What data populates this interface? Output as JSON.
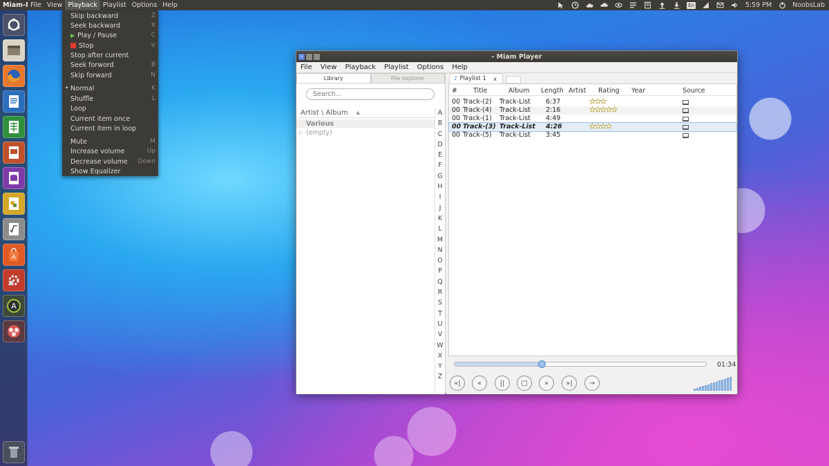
{
  "topbar": {
    "app_title": "Miam-Pl",
    "menus": [
      "File",
      "View",
      "Playback",
      "Playlist",
      "Options",
      "Help"
    ],
    "open_menu_index": 2,
    "time": "5:59 PM",
    "user": "NoobsLab",
    "keyboard_layout": "En",
    "indicator_icons": [
      "cursor-icon",
      "clock-icon",
      "weather-icon",
      "cloud-icon",
      "eye-icon",
      "list-icon",
      "bookmark-icon",
      "upload-icon",
      "download-icon",
      "keyboard-layout-icon",
      "network-icon",
      "mail-icon",
      "volume-icon",
      "power-icon"
    ]
  },
  "launcher": {
    "items": [
      "dash-icon",
      "files-icon",
      "firefox-icon",
      "writer-icon",
      "calc-icon",
      "impress-icon",
      "base-icon",
      "draw-icon",
      "math-icon",
      "software-center-icon",
      "system-settings-icon",
      "software-updater-icon",
      "miam-player-icon",
      "trash-icon"
    ]
  },
  "playback_menu": {
    "items": [
      {
        "label": "Skip backward",
        "shortcut": "Z"
      },
      {
        "label": "Seek backward",
        "shortcut": "X"
      },
      {
        "label": "Play / Pause",
        "shortcut": "C",
        "icon": "play-icon"
      },
      {
        "label": "Stop",
        "shortcut": "V",
        "icon": "stop-icon"
      },
      {
        "label": "Stop after current",
        "shortcut": ""
      },
      {
        "label": "Seek forword",
        "shortcut": "B"
      },
      {
        "label": "Skip forward",
        "shortcut": "N"
      },
      {
        "label": "Normal",
        "shortcut": "K",
        "checked": true
      },
      {
        "label": "Shuffle",
        "shortcut": "L"
      },
      {
        "label": "Loop",
        "shortcut": ""
      },
      {
        "label": "Current item once",
        "shortcut": ""
      },
      {
        "label": "Current item in loop",
        "shortcut": ""
      },
      {
        "label": "Mute",
        "shortcut": "M"
      },
      {
        "label": "Increase volume",
        "shortcut": "Up"
      },
      {
        "label": "Decrease volume",
        "shortcut": "Down"
      },
      {
        "label": "Show Equalizer",
        "shortcut": ""
      }
    ]
  },
  "window": {
    "title": "- Miam Player",
    "menus": [
      "File",
      "View",
      "Playback",
      "Playlist",
      "Options",
      "Help"
    ],
    "left_tabs": [
      "Library",
      "File explorer"
    ],
    "search_placeholder": "Search...",
    "library_header": "Artist \\ Album",
    "tree": [
      {
        "label": "Various",
        "kind": "group"
      },
      {
        "label": "(empty)",
        "kind": "item"
      }
    ],
    "alphabet": [
      "A",
      "B",
      "C",
      "D",
      "E",
      "F",
      "G",
      "H",
      "I",
      "J",
      "K",
      "L",
      "M",
      "N",
      "O",
      "P",
      "Q",
      "R",
      "S",
      "T",
      "U",
      "V",
      "W",
      "X",
      "Y",
      "Z"
    ],
    "playlist_tab": "Playlist 1",
    "playlist_tab_close": "x",
    "columns": [
      "#",
      "Title",
      "Album",
      "Length",
      "Artist",
      "Rating",
      "Year",
      "Source"
    ],
    "tracks": [
      {
        "num": "00",
        "title": "Track-(2)",
        "album": "Track-List",
        "length": "6:37",
        "artist": "",
        "rating": 3,
        "year": "",
        "current": false
      },
      {
        "num": "00",
        "title": "Track-(4)",
        "album": "Track-List",
        "length": "2:16",
        "artist": "",
        "rating": 5,
        "year": "",
        "current": false
      },
      {
        "num": "00",
        "title": "Track-(1)",
        "album": "Track-List",
        "length": "4:49",
        "artist": "",
        "rating": 0,
        "year": "",
        "current": false
      },
      {
        "num": "00",
        "title": "Track-(3)",
        "album": "Track-List",
        "length": "4:26",
        "artist": "",
        "rating": 4,
        "year": "",
        "current": true
      },
      {
        "num": "00",
        "title": "Track-(5)",
        "album": "Track-List",
        "length": "3:45",
        "artist": "",
        "rating": 0,
        "year": "",
        "current": false
      }
    ],
    "seek_fraction": 0.35,
    "time": "01:34",
    "volume_fraction": 1.0,
    "controls": [
      {
        "name": "skip-backward-button",
        "glyph": "«|"
      },
      {
        "name": "seek-backward-button",
        "glyph": "«"
      },
      {
        "name": "play-pause-button",
        "glyph": "||"
      },
      {
        "name": "stop-button",
        "glyph": "□"
      },
      {
        "name": "seek-forward-button",
        "glyph": "»"
      },
      {
        "name": "skip-forward-button",
        "glyph": "»|"
      },
      {
        "name": "playback-mode-button",
        "glyph": "→"
      }
    ]
  },
  "colors": {
    "panel": "#3c3b37",
    "menu_text": "#dfdbd2",
    "accent": "#9cc1ea",
    "play_green": "#73c84a",
    "stop_red": "#e23b2e"
  }
}
